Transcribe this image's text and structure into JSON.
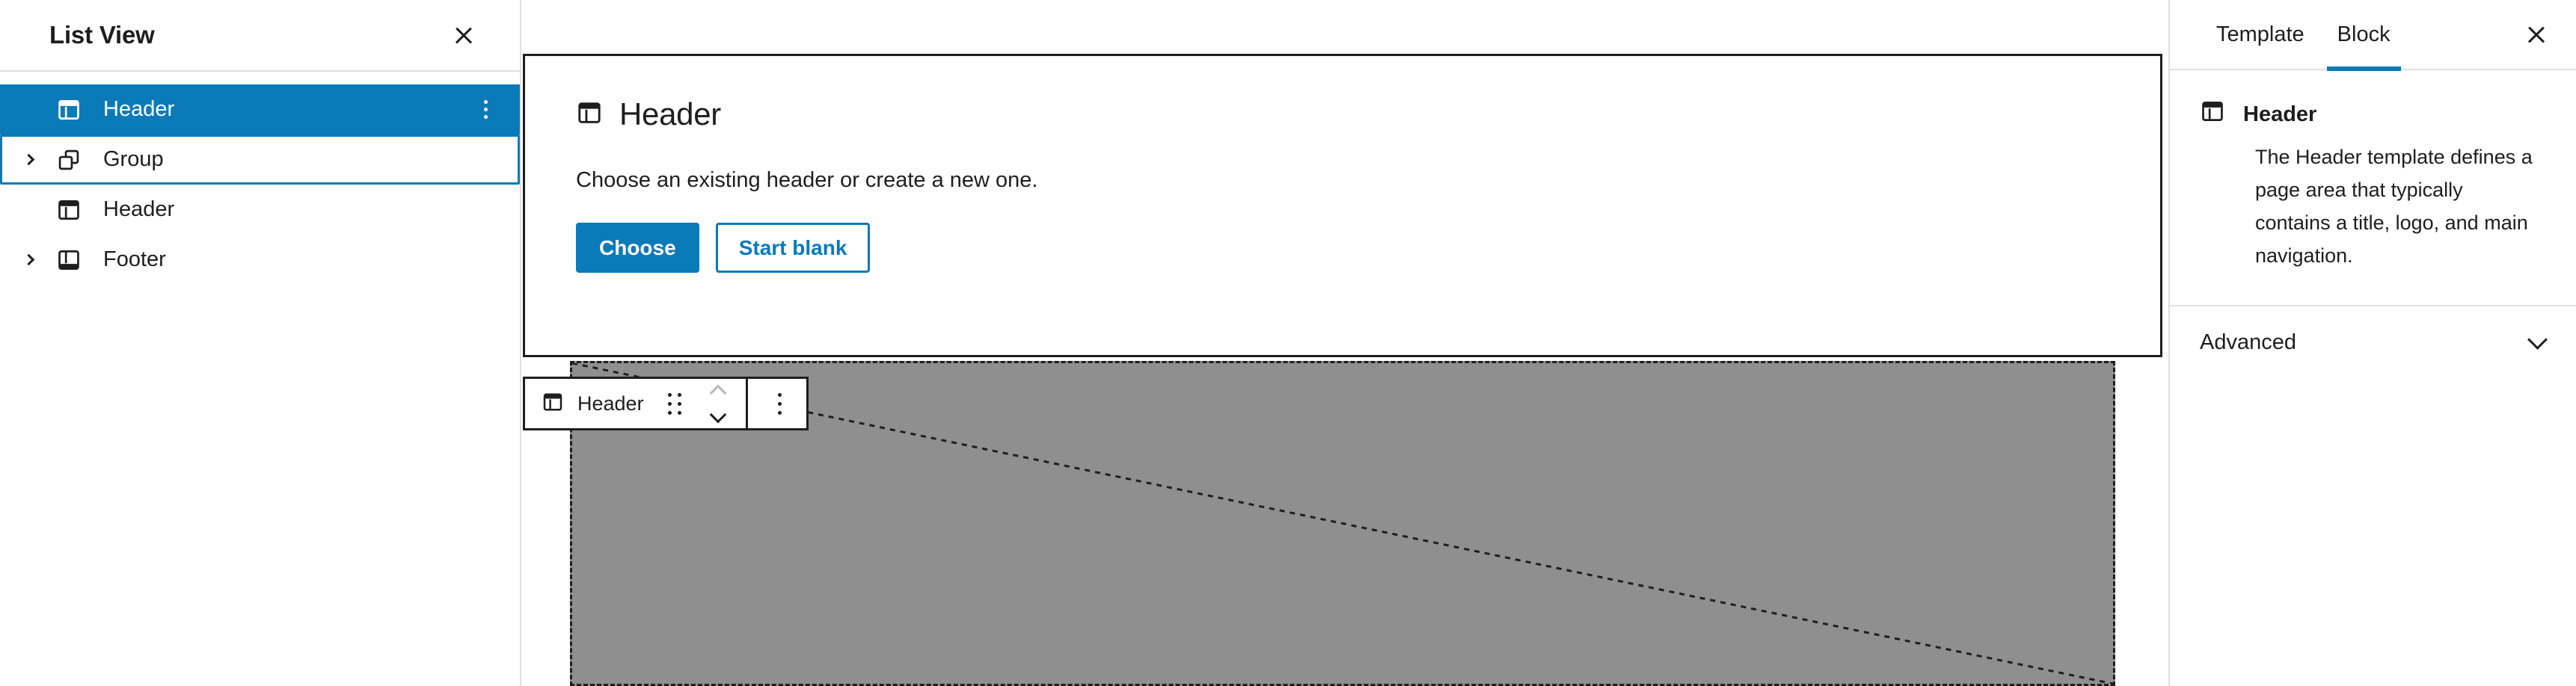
{
  "list_view": {
    "title": "List View",
    "close_icon": "close-icon",
    "items": [
      {
        "label": "Header",
        "icon": "template-part-header-icon",
        "expandable": false,
        "selected": true,
        "focused": false,
        "has_options": true,
        "options_icon": "kebab-vertical-icon"
      },
      {
        "label": "Group",
        "icon": "group-blocks-icon",
        "expandable": true,
        "selected": false,
        "focused": true,
        "has_options": false,
        "options_icon": ""
      },
      {
        "label": "Header",
        "icon": "template-part-header-icon",
        "expandable": false,
        "selected": false,
        "focused": false,
        "has_options": false,
        "options_icon": ""
      },
      {
        "label": "Footer",
        "icon": "template-part-footer-icon",
        "expandable": true,
        "selected": false,
        "focused": false,
        "has_options": false,
        "options_icon": ""
      }
    ]
  },
  "canvas": {
    "placeholder": {
      "icon": "template-part-header-icon",
      "title": "Header",
      "description": "Choose an existing header or create a new one.",
      "primary_button": "Choose",
      "secondary_button": "Start blank"
    },
    "block_toolbar": {
      "block_icon": "template-part-header-icon",
      "block_label": "Header",
      "drag_handle_icon": "drag-handle-icon",
      "move_up_icon": "chevron-up-icon",
      "move_down_icon": "chevron-down-icon",
      "options_icon": "kebab-vertical-icon"
    },
    "empty_block": {
      "fill_color": "#8f8f8f",
      "border_style": "dashed",
      "diagonal_marker": true
    }
  },
  "inspector": {
    "tabs": [
      {
        "label": "Template",
        "active": false
      },
      {
        "label": "Block",
        "active": true
      }
    ],
    "close_icon": "close-icon",
    "block": {
      "icon": "template-part-header-icon",
      "name": "Header",
      "description": "The Header template defines a page area that typically contains a title, logo, and main navigation."
    },
    "advanced": {
      "label": "Advanced",
      "expand_icon": "chevron-down-icon"
    }
  },
  "colors": {
    "accent": "#0b7ab8",
    "text": "#1e1e1e",
    "border": "#e0e0e0",
    "placeholder_fill": "#8f8f8f"
  }
}
